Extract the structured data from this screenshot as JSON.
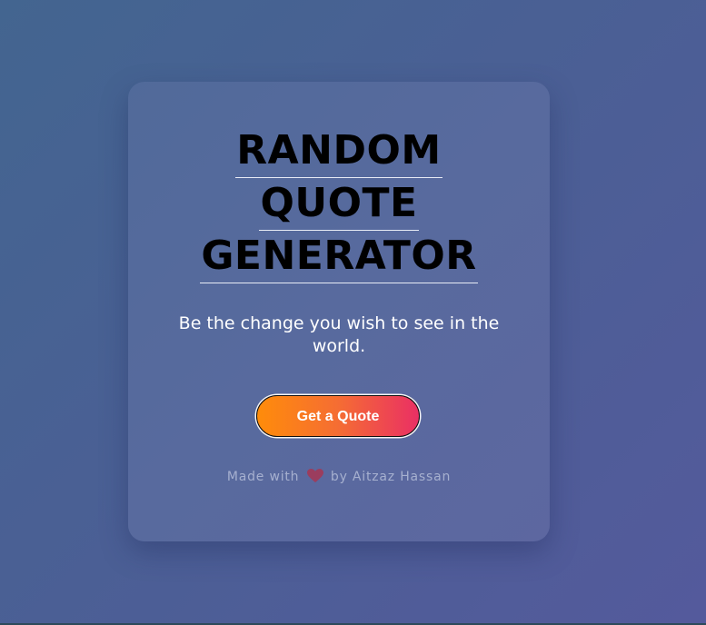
{
  "title_lines": [
    "RANDOM",
    "QUOTE",
    "GENERATOR"
  ],
  "quote": "Be the change you wish to see in the world.",
  "button_label": "Get a Quote",
  "footer": {
    "prefix": "Made with",
    "icon": "heart-icon",
    "suffix": "by Aitzaz Hassan"
  },
  "colors": {
    "background_start": "#436590",
    "background_end": "#545a9c",
    "card": "#586a9e",
    "button_start": "#ff8c0a",
    "button_end": "#ea2f64",
    "heart": "#9b3d5e",
    "footer_text": "#a6b0cf"
  }
}
